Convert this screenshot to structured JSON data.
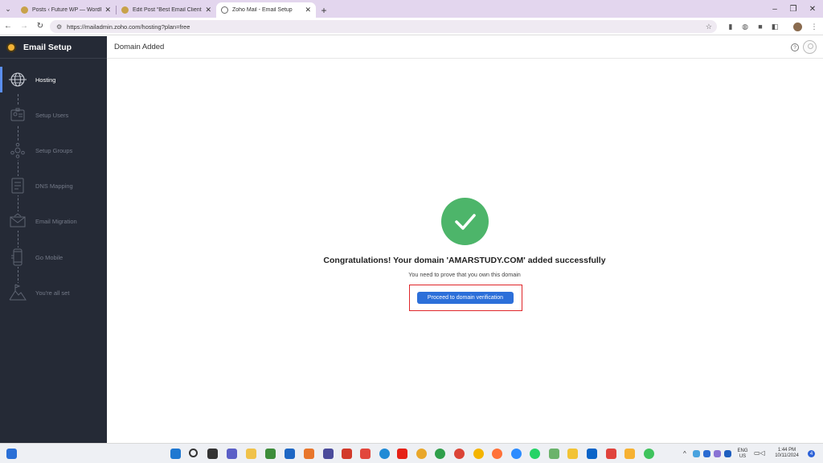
{
  "browser": {
    "tabs": [
      {
        "title": "Posts ‹ Future WP — WordPress",
        "active": false
      },
      {
        "title": "Edit Post “Best Email Client For",
        "active": false
      },
      {
        "title": "Zoho Mail - Email Setup",
        "active": true
      }
    ],
    "url": "https://mailadmin.zoho.com/hosting?plan=free"
  },
  "sidebar": {
    "title": "Email Setup",
    "items": [
      {
        "label": "Hosting",
        "icon": "globe-icon",
        "active": true
      },
      {
        "label": "Setup Users",
        "icon": "user-card-icon",
        "active": false
      },
      {
        "label": "Setup Groups",
        "icon": "groups-icon",
        "active": false
      },
      {
        "label": "DNS Mapping",
        "icon": "dns-document-icon",
        "active": false
      },
      {
        "label": "Email Migration",
        "icon": "envelope-icon",
        "active": false
      },
      {
        "label": "Go Mobile",
        "icon": "mobile-icon",
        "active": false
      },
      {
        "label": "You're all set",
        "icon": "flag-mountain-icon",
        "active": false
      }
    ]
  },
  "main": {
    "title": "Domain Added",
    "congrats": "Congratulations! Your domain 'AMARSTUDY.COM' added successfully",
    "subtext": "You need to prove that you own this domain",
    "button_label": "Proceed to domain verification"
  },
  "taskbar": {
    "lang_1": "ENG",
    "lang_2": "US",
    "time": "1:44 PM",
    "date": "10/11/2024",
    "notifications": "4"
  },
  "colors": {
    "sidebar_bg": "#252a36",
    "accent": "#2c6fd9",
    "success": "#4db56a",
    "highlight": "#e0262a"
  }
}
